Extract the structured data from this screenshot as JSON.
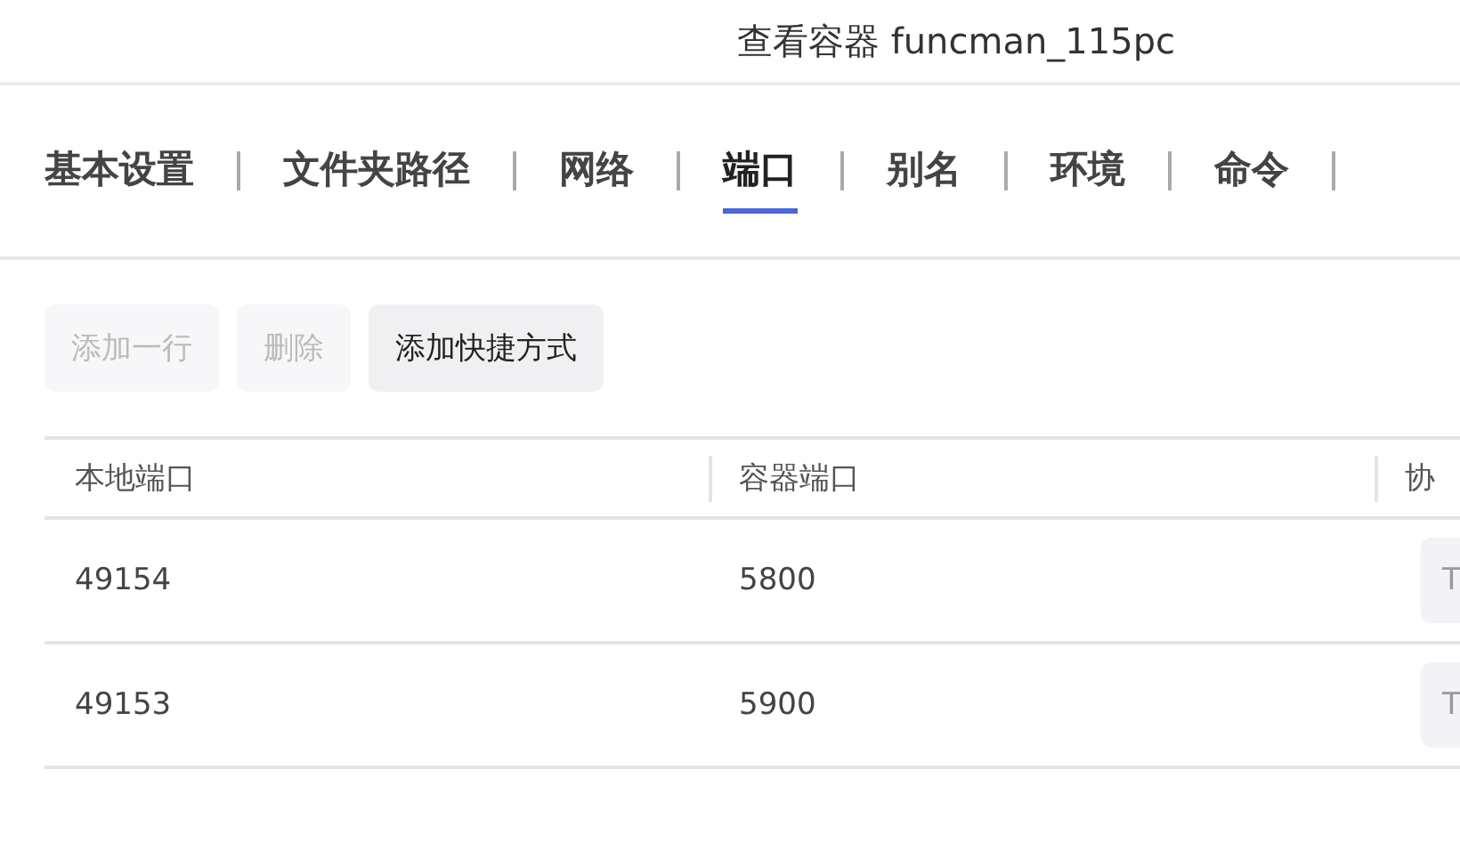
{
  "window": {
    "title": "查看容器 funcman_115pc"
  },
  "tabs": [
    {
      "label": "基本设置",
      "selected": false
    },
    {
      "label": "文件夹路径",
      "selected": false
    },
    {
      "label": "网络",
      "selected": false
    },
    {
      "label": "端口",
      "selected": true
    },
    {
      "label": "别名",
      "selected": false
    },
    {
      "label": "环境",
      "selected": false
    },
    {
      "label": "命令",
      "selected": false
    }
  ],
  "toolbar": [
    {
      "label": "添加一行",
      "disabled": true
    },
    {
      "label": "删除",
      "disabled": true
    },
    {
      "label": "添加快捷方式",
      "disabled": false
    }
  ],
  "table": {
    "columns": [
      "本地端口",
      "容器端口",
      "协"
    ],
    "rows": [
      {
        "local_port": "49154",
        "container_port": "5800",
        "protocol": "T"
      },
      {
        "local_port": "49153",
        "container_port": "5900",
        "protocol": "T"
      }
    ]
  }
}
